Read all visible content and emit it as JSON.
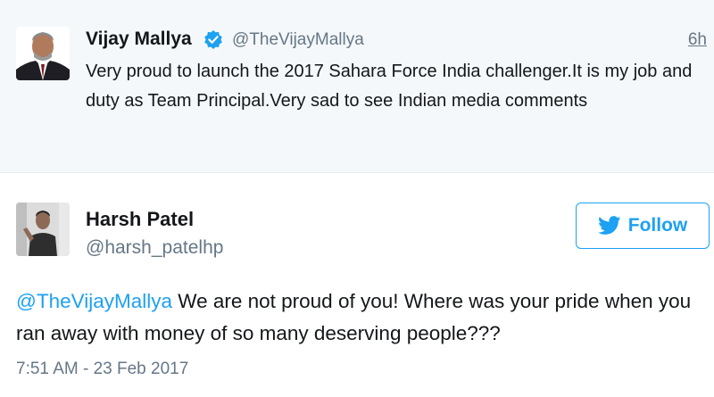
{
  "quoted_tweet": {
    "author_name": "Vijay Mallya",
    "author_handle": "@TheVijayMallya",
    "time": "6h",
    "text": "Very proud to launch the 2017 Sahara Force India challenger.It is my job and duty as Team Principal.Very sad to see Indian media comments"
  },
  "main_tweet": {
    "author_name": "Harsh Patel",
    "author_handle": "@harsh_patelhp",
    "follow_label": "Follow",
    "mention": "@TheVijayMallya",
    "text": " We are not proud of you! Where was your pride when you ran away with money of so many deserving people???",
    "timestamp": "7:51 AM - 23 Feb 2017"
  },
  "colors": {
    "accent": "#1da1f2",
    "secondary_text": "#657786",
    "quoted_background": "#f5f8fa"
  }
}
